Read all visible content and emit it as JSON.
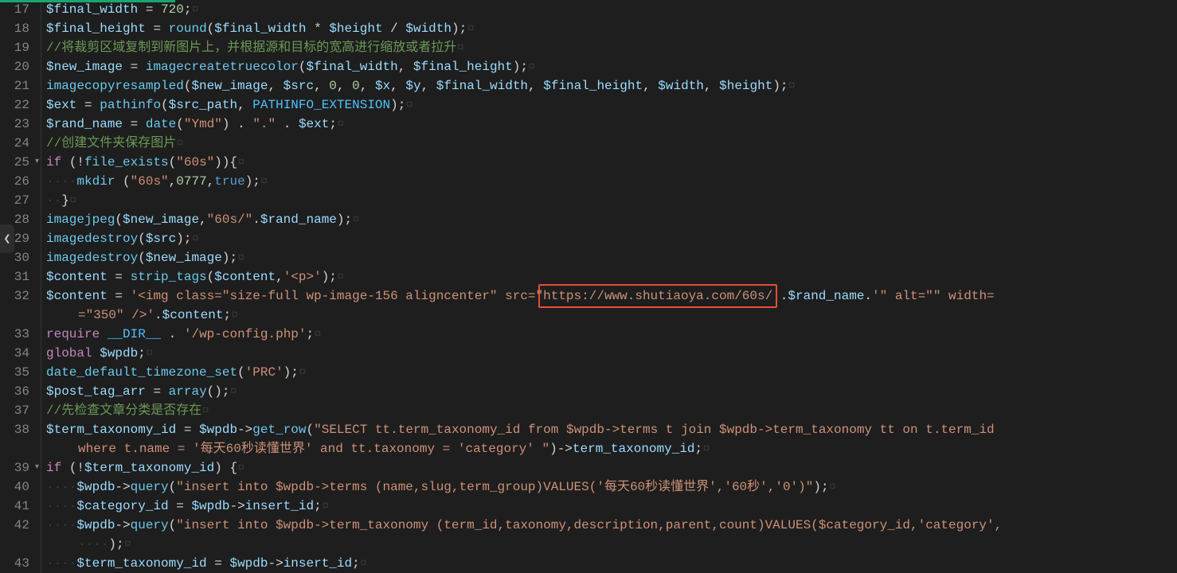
{
  "highlight_url": "https://www.shutiaoya.com/60s/",
  "lines": [
    {
      "n": 17,
      "fold": false,
      "tokens": [
        {
          "c": "var",
          "t": "$final_width"
        },
        {
          "c": "ws",
          "t": " "
        },
        {
          "c": "op",
          "t": "="
        },
        {
          "c": "ws",
          "t": " "
        },
        {
          "c": "num",
          "t": "720"
        },
        {
          "c": "punct",
          "t": ";"
        },
        {
          "c": "eol",
          "t": "¤"
        }
      ]
    },
    {
      "n": 18,
      "fold": false,
      "tokens": [
        {
          "c": "var",
          "t": "$final_height"
        },
        {
          "c": "ws",
          "t": " "
        },
        {
          "c": "op",
          "t": "="
        },
        {
          "c": "ws",
          "t": " "
        },
        {
          "c": "fn",
          "t": "round"
        },
        {
          "c": "punct",
          "t": "("
        },
        {
          "c": "var",
          "t": "$final_width"
        },
        {
          "c": "ws",
          "t": " "
        },
        {
          "c": "op",
          "t": "*"
        },
        {
          "c": "ws",
          "t": " "
        },
        {
          "c": "var",
          "t": "$height"
        },
        {
          "c": "ws",
          "t": " "
        },
        {
          "c": "op",
          "t": "/"
        },
        {
          "c": "ws",
          "t": " "
        },
        {
          "c": "var",
          "t": "$width"
        },
        {
          "c": "punct",
          "t": ");"
        },
        {
          "c": "eol",
          "t": "¤"
        }
      ]
    },
    {
      "n": 19,
      "fold": false,
      "tokens": [
        {
          "c": "comment",
          "t": "//将裁剪区域复制到新图片上，并根据源和目标的宽高进行缩放或者拉升"
        },
        {
          "c": "eol",
          "t": "¤"
        }
      ]
    },
    {
      "n": 20,
      "fold": false,
      "tokens": [
        {
          "c": "var",
          "t": "$new_image"
        },
        {
          "c": "ws",
          "t": " "
        },
        {
          "c": "op",
          "t": "="
        },
        {
          "c": "ws",
          "t": " "
        },
        {
          "c": "fn",
          "t": "imagecreatetruecolor"
        },
        {
          "c": "punct",
          "t": "("
        },
        {
          "c": "var",
          "t": "$final_width"
        },
        {
          "c": "punct",
          "t": ","
        },
        {
          "c": "ws",
          "t": " "
        },
        {
          "c": "var",
          "t": "$final_height"
        },
        {
          "c": "punct",
          "t": ");"
        },
        {
          "c": "eol",
          "t": "¤"
        }
      ]
    },
    {
      "n": 21,
      "fold": false,
      "tokens": [
        {
          "c": "fn",
          "t": "imagecopyresampled"
        },
        {
          "c": "punct",
          "t": "("
        },
        {
          "c": "var",
          "t": "$new_image"
        },
        {
          "c": "punct",
          "t": ","
        },
        {
          "c": "ws",
          "t": " "
        },
        {
          "c": "var",
          "t": "$src"
        },
        {
          "c": "punct",
          "t": ","
        },
        {
          "c": "ws",
          "t": " "
        },
        {
          "c": "num",
          "t": "0"
        },
        {
          "c": "punct",
          "t": ","
        },
        {
          "c": "ws",
          "t": " "
        },
        {
          "c": "num",
          "t": "0"
        },
        {
          "c": "punct",
          "t": ","
        },
        {
          "c": "ws",
          "t": " "
        },
        {
          "c": "var",
          "t": "$x"
        },
        {
          "c": "punct",
          "t": ","
        },
        {
          "c": "ws",
          "t": " "
        },
        {
          "c": "var",
          "t": "$y"
        },
        {
          "c": "punct",
          "t": ","
        },
        {
          "c": "ws",
          "t": " "
        },
        {
          "c": "var",
          "t": "$final_width"
        },
        {
          "c": "punct",
          "t": ","
        },
        {
          "c": "ws",
          "t": " "
        },
        {
          "c": "var",
          "t": "$final_height"
        },
        {
          "c": "punct",
          "t": ","
        },
        {
          "c": "ws",
          "t": " "
        },
        {
          "c": "var",
          "t": "$width"
        },
        {
          "c": "punct",
          "t": ","
        },
        {
          "c": "ws",
          "t": " "
        },
        {
          "c": "var",
          "t": "$height"
        },
        {
          "c": "punct",
          "t": ");"
        },
        {
          "c": "eol",
          "t": "¤"
        }
      ]
    },
    {
      "n": 22,
      "fold": false,
      "tokens": [
        {
          "c": "var",
          "t": "$ext"
        },
        {
          "c": "ws",
          "t": " "
        },
        {
          "c": "op",
          "t": "="
        },
        {
          "c": "ws",
          "t": " "
        },
        {
          "c": "fn",
          "t": "pathinfo"
        },
        {
          "c": "punct",
          "t": "("
        },
        {
          "c": "var",
          "t": "$src_path"
        },
        {
          "c": "punct",
          "t": ","
        },
        {
          "c": "ws",
          "t": " "
        },
        {
          "c": "const",
          "t": "PATHINFO_EXTENSION"
        },
        {
          "c": "punct",
          "t": ");"
        },
        {
          "c": "eol",
          "t": "¤"
        }
      ]
    },
    {
      "n": 23,
      "fold": false,
      "tokens": [
        {
          "c": "var",
          "t": "$rand_name"
        },
        {
          "c": "ws",
          "t": " "
        },
        {
          "c": "op",
          "t": "="
        },
        {
          "c": "ws",
          "t": " "
        },
        {
          "c": "fn",
          "t": "date"
        },
        {
          "c": "punct",
          "t": "("
        },
        {
          "c": "str",
          "t": "\"Ymd\""
        },
        {
          "c": "punct",
          "t": ")"
        },
        {
          "c": "ws",
          "t": " "
        },
        {
          "c": "op",
          "t": "."
        },
        {
          "c": "ws",
          "t": " "
        },
        {
          "c": "str",
          "t": "\".\""
        },
        {
          "c": "ws",
          "t": " "
        },
        {
          "c": "op",
          "t": "."
        },
        {
          "c": "ws",
          "t": " "
        },
        {
          "c": "var",
          "t": "$ext"
        },
        {
          "c": "punct",
          "t": ";"
        },
        {
          "c": "eol",
          "t": "¤"
        }
      ]
    },
    {
      "n": 24,
      "fold": false,
      "tokens": [
        {
          "c": "comment",
          "t": "//创建文件夹保存图片"
        },
        {
          "c": "eol",
          "t": "¤"
        }
      ]
    },
    {
      "n": 25,
      "fold": true,
      "tokens": [
        {
          "c": "kw",
          "t": "if"
        },
        {
          "c": "ws",
          "t": " "
        },
        {
          "c": "punct",
          "t": "("
        },
        {
          "c": "op",
          "t": "!"
        },
        {
          "c": "fn",
          "t": "file_exists"
        },
        {
          "c": "punct",
          "t": "("
        },
        {
          "c": "str",
          "t": "\"60s\""
        },
        {
          "c": "punct",
          "t": ")){"
        },
        {
          "c": "eol",
          "t": "¤"
        }
      ]
    },
    {
      "n": 26,
      "fold": false,
      "tokens": [
        {
          "c": "ws",
          "t": "····"
        },
        {
          "c": "fn",
          "t": "mkdir"
        },
        {
          "c": "ws",
          "t": " "
        },
        {
          "c": "punct",
          "t": "("
        },
        {
          "c": "str",
          "t": "\"60s\""
        },
        {
          "c": "punct",
          "t": ","
        },
        {
          "c": "num",
          "t": "0777"
        },
        {
          "c": "punct",
          "t": ","
        },
        {
          "c": "bool",
          "t": "true"
        },
        {
          "c": "punct",
          "t": ");"
        },
        {
          "c": "eol",
          "t": "¤"
        }
      ]
    },
    {
      "n": 27,
      "fold": false,
      "tokens": [
        {
          "c": "ws",
          "t": "··"
        },
        {
          "c": "punct",
          "t": "}"
        },
        {
          "c": "eol",
          "t": "¤"
        }
      ]
    },
    {
      "n": 28,
      "fold": false,
      "tokens": [
        {
          "c": "fn",
          "t": "imagejpeg"
        },
        {
          "c": "punct",
          "t": "("
        },
        {
          "c": "var",
          "t": "$new_image"
        },
        {
          "c": "punct",
          "t": ","
        },
        {
          "c": "str",
          "t": "\"60s/\""
        },
        {
          "c": "op",
          "t": "."
        },
        {
          "c": "var",
          "t": "$rand_name"
        },
        {
          "c": "punct",
          "t": ");"
        },
        {
          "c": "eol",
          "t": "¤"
        }
      ]
    },
    {
      "n": 29,
      "fold": false,
      "tokens": [
        {
          "c": "fn",
          "t": "imagedestroy"
        },
        {
          "c": "punct",
          "t": "("
        },
        {
          "c": "var",
          "t": "$src"
        },
        {
          "c": "punct",
          "t": ");"
        },
        {
          "c": "eol",
          "t": "¤"
        }
      ]
    },
    {
      "n": 30,
      "fold": false,
      "tokens": [
        {
          "c": "fn",
          "t": "imagedestroy"
        },
        {
          "c": "punct",
          "t": "("
        },
        {
          "c": "var",
          "t": "$new_image"
        },
        {
          "c": "punct",
          "t": ");"
        },
        {
          "c": "eol",
          "t": "¤"
        }
      ]
    },
    {
      "n": 31,
      "fold": false,
      "tokens": [
        {
          "c": "var",
          "t": "$content"
        },
        {
          "c": "ws",
          "t": " "
        },
        {
          "c": "op",
          "t": "="
        },
        {
          "c": "ws",
          "t": " "
        },
        {
          "c": "fn",
          "t": "strip_tags"
        },
        {
          "c": "punct",
          "t": "("
        },
        {
          "c": "var",
          "t": "$content"
        },
        {
          "c": "punct",
          "t": ","
        },
        {
          "c": "str",
          "t": "'<p>'"
        },
        {
          "c": "punct",
          "t": ");"
        },
        {
          "c": "eol",
          "t": "¤"
        }
      ]
    },
    {
      "n": 32,
      "fold": false,
      "tokens": [
        {
          "c": "var",
          "t": "$content"
        },
        {
          "c": "ws",
          "t": " "
        },
        {
          "c": "op",
          "t": "="
        },
        {
          "c": "ws",
          "t": " "
        },
        {
          "c": "str",
          "t": "'<img class=\"size-full wp-image-156 aligncenter\" src=\""
        },
        {
          "c": "str",
          "t": "https://www.shutiaoya.com/60s/"
        },
        {
          "c": "str",
          "t": "'"
        },
        {
          "c": "op",
          "t": "."
        },
        {
          "c": "var",
          "t": "$rand_name"
        },
        {
          "c": "op",
          "t": "."
        },
        {
          "c": "str",
          "t": "'\" alt=\"\" width="
        }
      ],
      "wrap": [
        {
          "c": "str",
          "t": "=\"350\" />'"
        },
        {
          "c": "op",
          "t": "."
        },
        {
          "c": "var",
          "t": "$content"
        },
        {
          "c": "punct",
          "t": ";"
        },
        {
          "c": "eol",
          "t": "¤"
        }
      ]
    },
    {
      "n": 33,
      "fold": false,
      "tokens": [
        {
          "c": "kw",
          "t": "require"
        },
        {
          "c": "ws",
          "t": " "
        },
        {
          "c": "const",
          "t": "__DIR__"
        },
        {
          "c": "ws",
          "t": " "
        },
        {
          "c": "op",
          "t": "."
        },
        {
          "c": "ws",
          "t": " "
        },
        {
          "c": "str",
          "t": "'/wp-config.php'"
        },
        {
          "c": "punct",
          "t": ";"
        },
        {
          "c": "eol",
          "t": "¤"
        }
      ]
    },
    {
      "n": 34,
      "fold": false,
      "tokens": [
        {
          "c": "kw",
          "t": "global"
        },
        {
          "c": "ws",
          "t": " "
        },
        {
          "c": "var",
          "t": "$wpdb"
        },
        {
          "c": "punct",
          "t": ";"
        },
        {
          "c": "eol",
          "t": "¤"
        }
      ]
    },
    {
      "n": 35,
      "fold": false,
      "tokens": [
        {
          "c": "fn",
          "t": "date_default_timezone_set"
        },
        {
          "c": "punct",
          "t": "("
        },
        {
          "c": "str",
          "t": "'PRC'"
        },
        {
          "c": "punct",
          "t": ");"
        },
        {
          "c": "eol",
          "t": "¤"
        }
      ]
    },
    {
      "n": 36,
      "fold": false,
      "tokens": [
        {
          "c": "var",
          "t": "$post_tag_arr"
        },
        {
          "c": "ws",
          "t": " "
        },
        {
          "c": "op",
          "t": "="
        },
        {
          "c": "ws",
          "t": " "
        },
        {
          "c": "fn",
          "t": "array"
        },
        {
          "c": "punct",
          "t": "();"
        },
        {
          "c": "eol",
          "t": "¤"
        }
      ]
    },
    {
      "n": 37,
      "fold": false,
      "tokens": [
        {
          "c": "comment",
          "t": "//先检查文章分类是否存在"
        },
        {
          "c": "eol",
          "t": "¤"
        }
      ]
    },
    {
      "n": 38,
      "fold": false,
      "tokens": [
        {
          "c": "var",
          "t": "$term_taxonomy_id"
        },
        {
          "c": "ws",
          "t": " "
        },
        {
          "c": "op",
          "t": "="
        },
        {
          "c": "ws",
          "t": " "
        },
        {
          "c": "var",
          "t": "$wpdb"
        },
        {
          "c": "op",
          "t": "->"
        },
        {
          "c": "fn",
          "t": "get_row"
        },
        {
          "c": "punct",
          "t": "("
        },
        {
          "c": "str",
          "t": "\"SELECT tt.term_taxonomy_id from $wpdb->terms t join $wpdb->term_taxonomy tt on t.term_id "
        }
      ],
      "wrap": [
        {
          "c": "str",
          "t": "where t.name = '每天60秒读懂世界' and tt.taxonomy = 'category' \""
        },
        {
          "c": "punct",
          "t": ")"
        },
        {
          "c": "op",
          "t": "->"
        },
        {
          "c": "var",
          "t": "term_taxonomy_id"
        },
        {
          "c": "punct",
          "t": ";"
        },
        {
          "c": "eol",
          "t": "¤"
        }
      ]
    },
    {
      "n": 39,
      "fold": true,
      "tokens": [
        {
          "c": "kw",
          "t": "if"
        },
        {
          "c": "ws",
          "t": " "
        },
        {
          "c": "punct",
          "t": "("
        },
        {
          "c": "op",
          "t": "!"
        },
        {
          "c": "var",
          "t": "$term_taxonomy_id"
        },
        {
          "c": "punct",
          "t": ")"
        },
        {
          "c": "ws",
          "t": " "
        },
        {
          "c": "punct",
          "t": "{"
        },
        {
          "c": "eol",
          "t": "¤"
        }
      ]
    },
    {
      "n": 40,
      "fold": false,
      "tokens": [
        {
          "c": "ws",
          "t": "····"
        },
        {
          "c": "var",
          "t": "$wpdb"
        },
        {
          "c": "op",
          "t": "->"
        },
        {
          "c": "fn",
          "t": "query"
        },
        {
          "c": "punct",
          "t": "("
        },
        {
          "c": "str",
          "t": "\"insert into $wpdb->terms (name,slug,term_group)VALUES('每天60秒读懂世界','60秒','0')\""
        },
        {
          "c": "punct",
          "t": ");"
        },
        {
          "c": "eol",
          "t": "¤"
        }
      ]
    },
    {
      "n": 41,
      "fold": false,
      "tokens": [
        {
          "c": "ws",
          "t": "····"
        },
        {
          "c": "var",
          "t": "$category_id"
        },
        {
          "c": "ws",
          "t": " "
        },
        {
          "c": "op",
          "t": "="
        },
        {
          "c": "ws",
          "t": " "
        },
        {
          "c": "var",
          "t": "$wpdb"
        },
        {
          "c": "op",
          "t": "->"
        },
        {
          "c": "var",
          "t": "insert_id"
        },
        {
          "c": "punct",
          "t": ";"
        },
        {
          "c": "eol",
          "t": "¤"
        }
      ]
    },
    {
      "n": 42,
      "fold": false,
      "tokens": [
        {
          "c": "ws",
          "t": "····"
        },
        {
          "c": "var",
          "t": "$wpdb"
        },
        {
          "c": "op",
          "t": "->"
        },
        {
          "c": "fn",
          "t": "query"
        },
        {
          "c": "punct",
          "t": "("
        },
        {
          "c": "str",
          "t": "\"insert into $wpdb->term_taxonomy (term_id,taxonomy,description,parent,count)VALUES($category_id,'category',"
        }
      ],
      "wrap": [
        {
          "c": "ws",
          "t": "····"
        },
        {
          "c": "punct",
          "t": ");"
        },
        {
          "c": "eol",
          "t": "¤"
        }
      ]
    },
    {
      "n": 43,
      "fold": false,
      "tokens": [
        {
          "c": "ws",
          "t": "····"
        },
        {
          "c": "var",
          "t": "$term_taxonomy_id"
        },
        {
          "c": "ws",
          "t": " "
        },
        {
          "c": "op",
          "t": "="
        },
        {
          "c": "ws",
          "t": " "
        },
        {
          "c": "var",
          "t": "$wpdb"
        },
        {
          "c": "op",
          "t": "->"
        },
        {
          "c": "var",
          "t": "insert_id"
        },
        {
          "c": "punct",
          "t": ";"
        },
        {
          "c": "eol",
          "t": "¤"
        }
      ]
    }
  ]
}
